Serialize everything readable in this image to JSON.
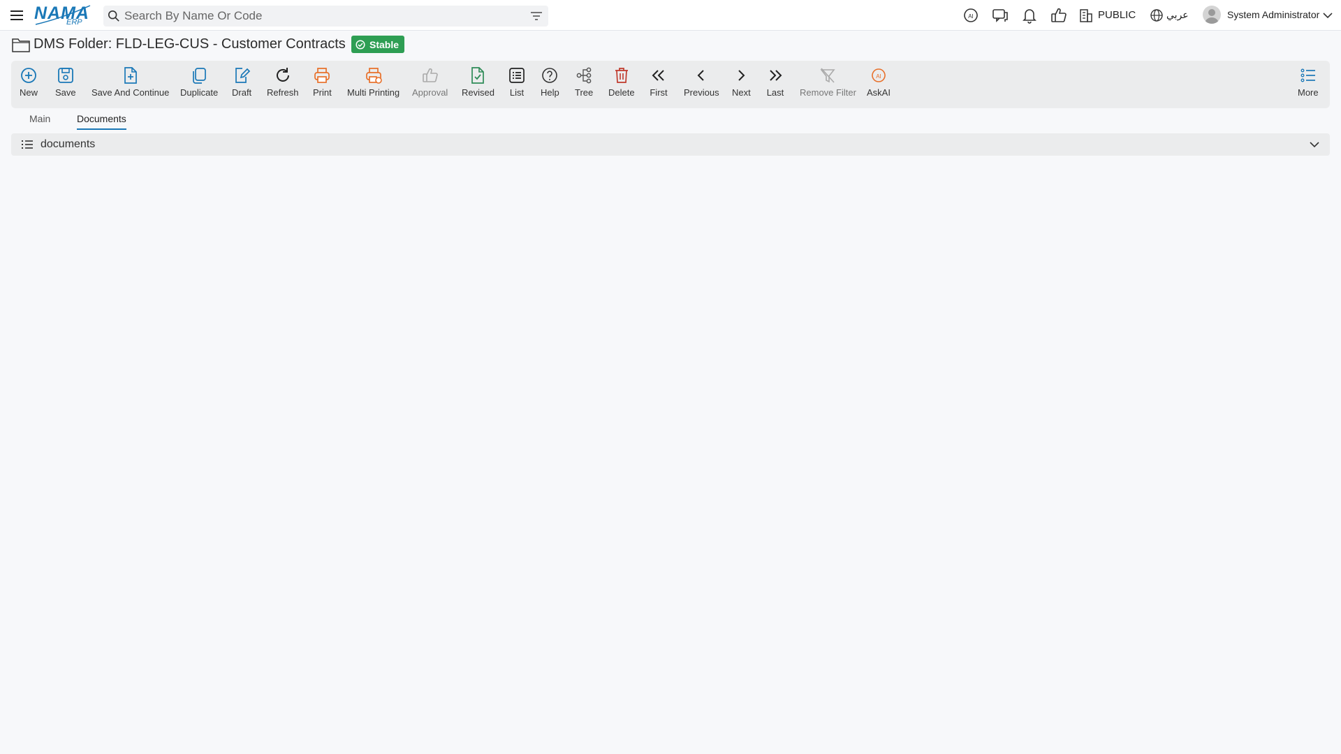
{
  "app": {
    "logo_text": "NAMA",
    "logo_sub": "ERP",
    "menu_icon": "hamburger-icon"
  },
  "search": {
    "placeholder": "Search By Name Or Code",
    "value": "",
    "icon": "search-icon",
    "filter_icon": "filter-icon"
  },
  "topbar": {
    "ai_icon": "ai-chat-icon",
    "chat_icon": "chat-icon",
    "bell_icon": "bell-icon",
    "like_icon": "thumbs-up-icon",
    "branch_label": "PUBLIC",
    "branch_icon": "building-icon",
    "language_label": "عربي",
    "language_icon": "globe-icon",
    "user_name": "System Administrator",
    "user_menu_icon": "chevron-down-icon"
  },
  "header": {
    "title": "DMS Folder: FLD-LEG-CUS - Customer Contracts",
    "status_badge": "Stable",
    "status_color": "#2e9e53"
  },
  "toolbar": {
    "new": "New",
    "save": "Save",
    "save_continue": "Save And Continue",
    "duplicate": "Duplicate",
    "draft": "Draft",
    "refresh": "Refresh",
    "print": "Print",
    "multi_printing": "Multi Printing",
    "approval": "Approval",
    "revised": "Revised",
    "list": "List",
    "help": "Help",
    "tree": "Tree",
    "delete": "Delete",
    "first": "First",
    "previous": "Previous",
    "next": "Next",
    "last": "Last",
    "remove_filter": "Remove Filter",
    "askai": "AskAI",
    "more": "More"
  },
  "tabs": [
    {
      "label": "Main",
      "active": false
    },
    {
      "label": "Documents",
      "active": true
    }
  ],
  "section": {
    "label": "documents",
    "icon": "list-icon",
    "toggle_icon": "chevron-down-icon"
  },
  "colors": {
    "primary": "#1a78b7",
    "orange": "#e8702a",
    "green": "#2e8b57",
    "danger": "#c0392b"
  }
}
